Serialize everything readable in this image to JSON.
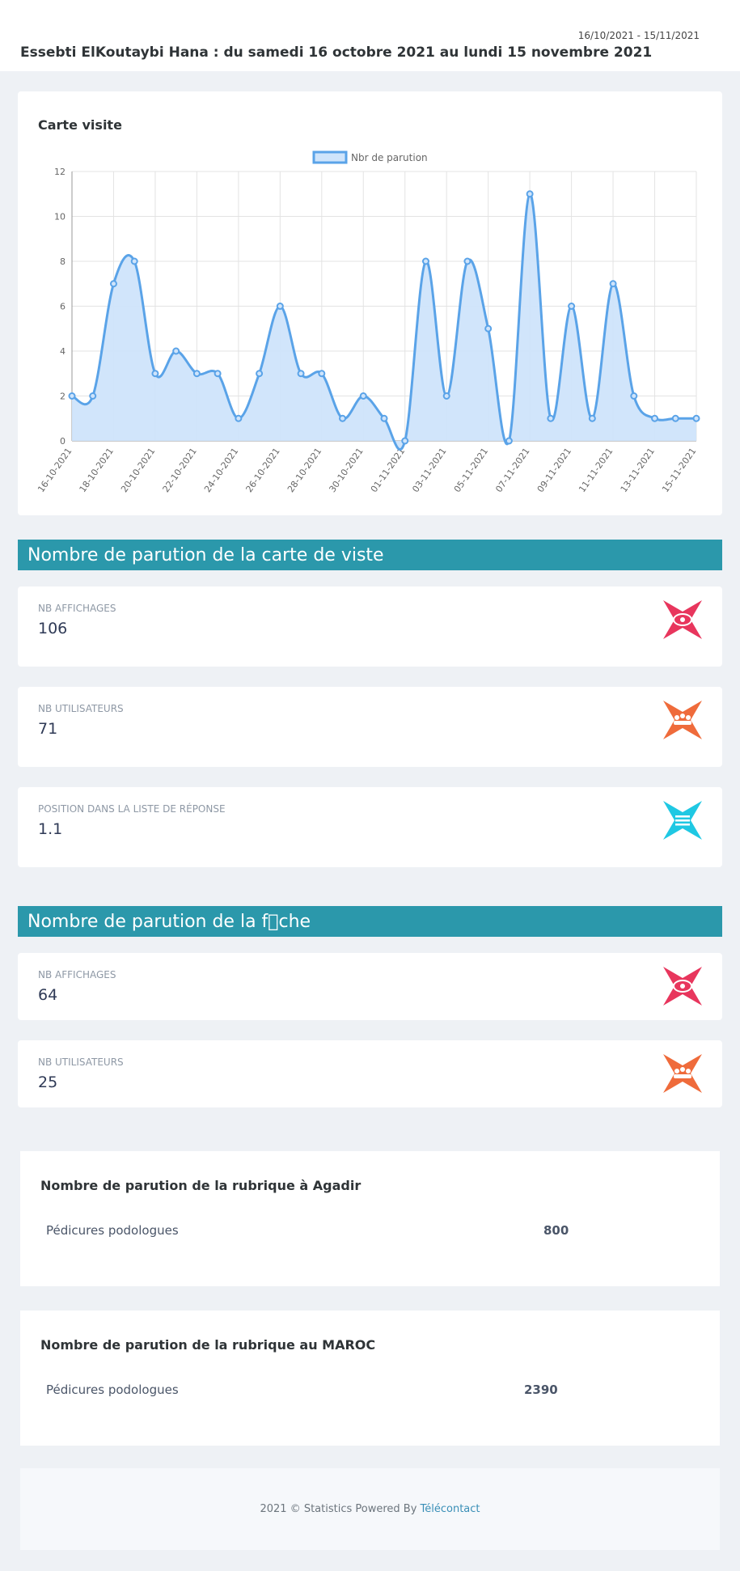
{
  "header": {
    "daterange": "16/10/2021 - 15/11/2021",
    "title": "Essebti ElKoutaybi Hana : du samedi 16 octobre 2021 au lundi 15 novembre 2021"
  },
  "chart_card": {
    "title": "Carte visite"
  },
  "chart_data": {
    "type": "area",
    "title": "",
    "xlabel": "",
    "ylabel": "",
    "legend": "top-center",
    "grid": true,
    "ylim": [
      0,
      12
    ],
    "yticks": [
      0,
      2,
      4,
      6,
      8,
      10,
      12
    ],
    "x_tick_labels": [
      "16-10-2021",
      "18-10-2021",
      "20-10-2021",
      "22-10-2021",
      "24-10-2021",
      "26-10-2021",
      "28-10-2021",
      "30-10-2021",
      "01-11-2021",
      "03-11-2021",
      "05-11-2021",
      "07-11-2021",
      "09-11-2021",
      "11-11-2021",
      "13-11-2021",
      "15-11-2021"
    ],
    "x": [
      "16-10-2021",
      "17-10-2021",
      "18-10-2021",
      "19-10-2021",
      "20-10-2021",
      "21-10-2021",
      "22-10-2021",
      "23-10-2021",
      "24-10-2021",
      "25-10-2021",
      "26-10-2021",
      "27-10-2021",
      "28-10-2021",
      "29-10-2021",
      "30-10-2021",
      "31-10-2021",
      "01-11-2021",
      "02-11-2021",
      "03-11-2021",
      "04-11-2021",
      "05-11-2021",
      "06-11-2021",
      "07-11-2021",
      "08-11-2021",
      "09-11-2021",
      "10-11-2021",
      "11-11-2021",
      "12-11-2021",
      "13-11-2021",
      "14-11-2021",
      "15-11-2021"
    ],
    "series": [
      {
        "name": "Nbr de parution",
        "color": "#5aa3e8",
        "fill": "#cfe4fb",
        "values": [
          2,
          2,
          7,
          8,
          3,
          4,
          3,
          3,
          1,
          3,
          6,
          3,
          3,
          1,
          2,
          1,
          0,
          8,
          2,
          8,
          5,
          0,
          11,
          1,
          6,
          1,
          7,
          2,
          1,
          1,
          1
        ]
      }
    ]
  },
  "section1": {
    "banner": "Nombre de parution de la carte de viste",
    "stats": [
      {
        "label": "NB AFFICHAGES",
        "value": "106",
        "icon": "eye-icon",
        "color": "#e8365d"
      },
      {
        "label": "NB UTILISATEURS",
        "value": "71",
        "icon": "users-icon",
        "color": "#ef6b3b"
      },
      {
        "label": "POSITION DANS LA LISTE DE RÉPONSE",
        "value": "1.1",
        "icon": "list-icon",
        "color": "#1fc8e3"
      }
    ]
  },
  "section2": {
    "banner": "Nombre de parution de la f\u0000che",
    "stats": [
      {
        "label": "NB AFFICHAGES",
        "value": "64",
        "icon": "eye-icon",
        "color": "#e8365d"
      },
      {
        "label": "NB UTILISATEURS",
        "value": "25",
        "icon": "users-icon",
        "color": "#ef6b3b"
      }
    ]
  },
  "rubric_agadir": {
    "title": "Nombre de parution de la rubrique à Agadir",
    "name": "Pédicures podologues",
    "value": "800"
  },
  "rubric_maroc": {
    "title": "Nombre de parution de la rubrique au MAROC",
    "name": "Pédicures podologues",
    "value": "2390"
  },
  "footer": {
    "text": "2021 © Statistics Powered By ",
    "link": "Télécontact"
  }
}
